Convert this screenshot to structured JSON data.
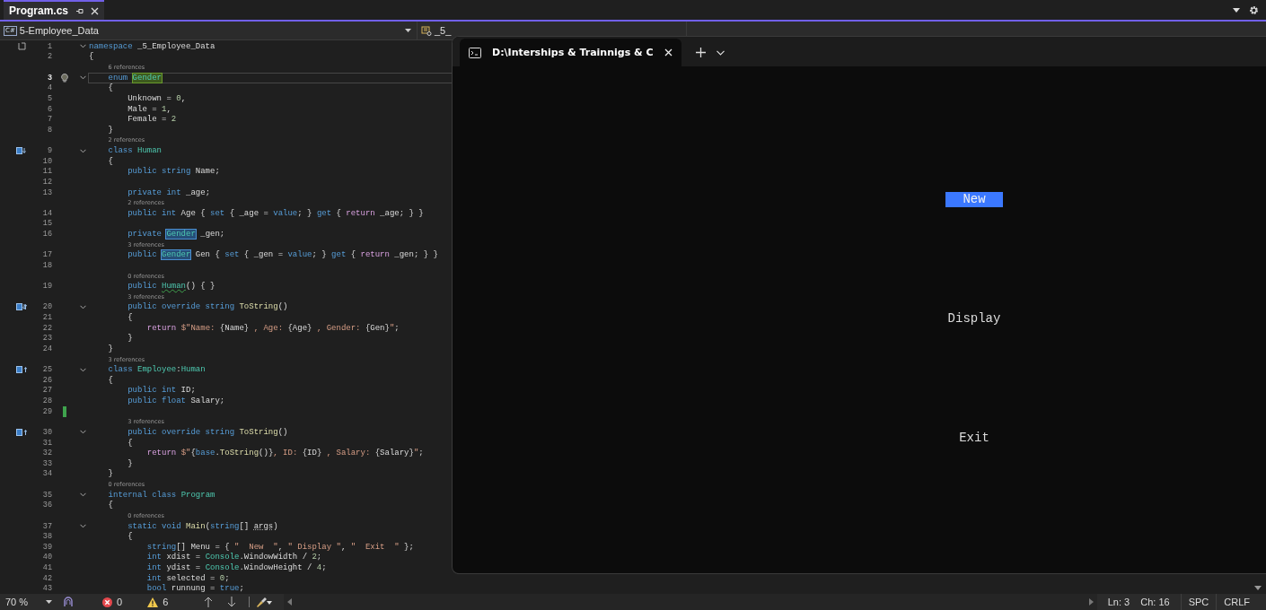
{
  "tabs": [
    {
      "label": "Program.cs",
      "selected": true
    }
  ],
  "nav": {
    "badge": "C#",
    "project": "5-Employee_Data",
    "member": "_5_"
  },
  "lines": [
    {
      "n": "1",
      "fold": true,
      "current": false,
      "margin": {
        "kind": "scope"
      },
      "tokens": [
        {
          "kind": "keyword",
          "t": "namespace"
        },
        {
          "kind": "plain",
          "t": " _5_Employee_Data"
        }
      ]
    },
    {
      "n": "2",
      "fold": false,
      "current": false,
      "tokens": [
        {
          "kind": "plain",
          "t": "{"
        }
      ]
    },
    {
      "n": "3",
      "lens": "6 references",
      "fold": true,
      "current": true,
      "gutter": {
        "kind": "bulb"
      },
      "tokens": [
        {
          "kind": "keyword",
          "t": "    enum "
        },
        {
          "kind": "definition",
          "t": "Gender"
        }
      ]
    },
    {
      "n": "4",
      "fold": false,
      "current": false,
      "tokens": [
        {
          "kind": "plain",
          "t": "    {"
        }
      ]
    },
    {
      "n": "5",
      "fold": false,
      "current": false,
      "tokens": [
        {
          "kind": "plain",
          "t": "        Unknown = "
        },
        {
          "kind": "number",
          "t": "0"
        },
        {
          "kind": "plain",
          "t": ","
        }
      ]
    },
    {
      "n": "6",
      "fold": false,
      "current": false,
      "tokens": [
        {
          "kind": "plain",
          "t": "        Male = "
        },
        {
          "kind": "number",
          "t": "1"
        },
        {
          "kind": "plain",
          "t": ","
        }
      ]
    },
    {
      "n": "7",
      "fold": false,
      "current": false,
      "tokens": [
        {
          "kind": "plain",
          "t": "        Female = "
        },
        {
          "kind": "number",
          "t": "2"
        }
      ]
    },
    {
      "n": "8",
      "fold": false,
      "current": false,
      "tokens": [
        {
          "kind": "plain",
          "t": "    }"
        }
      ]
    },
    {
      "n": "9",
      "lens": "2 references",
      "fold": true,
      "current": false,
      "margin": {
        "kind": "overridden"
      },
      "tokens": [
        {
          "kind": "keyword",
          "t": "    class "
        },
        {
          "kind": "type",
          "t": "Human"
        }
      ]
    },
    {
      "n": "10",
      "fold": false,
      "current": false,
      "tokens": [
        {
          "kind": "plain",
          "t": "    {"
        }
      ]
    },
    {
      "n": "11",
      "fold": false,
      "current": false,
      "tokens": [
        {
          "kind": "keyword",
          "t": "        public string"
        },
        {
          "kind": "plain",
          "t": " Name;"
        }
      ]
    },
    {
      "n": "12",
      "fold": false,
      "current": false
    },
    {
      "n": "13",
      "fold": false,
      "current": false,
      "tokens": [
        {
          "kind": "keyword",
          "t": "        private int"
        },
        {
          "kind": "plain",
          "t": " _age;"
        }
      ]
    },
    {
      "n": "14",
      "lens": "2 references",
      "fold": false,
      "current": false,
      "tokens": [
        {
          "kind": "keyword",
          "t": "        public int"
        },
        {
          "kind": "plain",
          "t": " Age { "
        },
        {
          "kind": "keyword",
          "t": "set"
        },
        {
          "kind": "plain",
          "t": " { _age = "
        },
        {
          "kind": "keyword",
          "t": "value"
        },
        {
          "kind": "plain",
          "t": "; } "
        },
        {
          "kind": "keyword",
          "t": "get"
        },
        {
          "kind": "plain",
          "t": " { "
        },
        {
          "kind": "control",
          "t": "return"
        },
        {
          "kind": "plain",
          "t": " _age; } }"
        }
      ]
    },
    {
      "n": "15",
      "fold": false,
      "current": false
    },
    {
      "n": "16",
      "fold": false,
      "current": false,
      "tokens": [
        {
          "kind": "keyword",
          "t": "        private "
        },
        {
          "kind": "reference",
          "t": "Gender"
        },
        {
          "kind": "plain",
          "t": " _gen;"
        }
      ]
    },
    {
      "n": "17",
      "lens": "3 references",
      "fold": false,
      "current": false,
      "tokens": [
        {
          "kind": "keyword",
          "t": "        public "
        },
        {
          "kind": "reference",
          "t": "Gender"
        },
        {
          "kind": "plain",
          "t": " Gen { "
        },
        {
          "kind": "keyword",
          "t": "set"
        },
        {
          "kind": "plain",
          "t": " { _gen = "
        },
        {
          "kind": "keyword",
          "t": "value"
        },
        {
          "kind": "plain",
          "t": "; } "
        },
        {
          "kind": "keyword",
          "t": "get"
        },
        {
          "kind": "plain",
          "t": " { "
        },
        {
          "kind": "control",
          "t": "return"
        },
        {
          "kind": "plain",
          "t": " _gen; } }"
        }
      ]
    },
    {
      "n": "18",
      "fold": false,
      "current": false
    },
    {
      "n": "19",
      "lens": "0 references",
      "fold": false,
      "current": false,
      "tokens": [
        {
          "kind": "keyword",
          "t": "        public "
        },
        {
          "kind": "squiggled",
          "t": "Human"
        },
        {
          "kind": "plain",
          "t": "() { }"
        }
      ]
    },
    {
      "n": "20",
      "lens": "3 references",
      "fold": true,
      "current": false,
      "margin": {
        "kind": "both"
      },
      "tokens": [
        {
          "kind": "keyword",
          "t": "        public override string "
        },
        {
          "kind": "method",
          "t": "ToString"
        },
        {
          "kind": "plain",
          "t": "()"
        }
      ]
    },
    {
      "n": "21",
      "fold": false,
      "current": false,
      "tokens": [
        {
          "kind": "plain",
          "t": "        {"
        }
      ]
    },
    {
      "n": "22",
      "fold": false,
      "current": false,
      "tokens": [
        {
          "kind": "control",
          "t": "            return "
        },
        {
          "kind": "string",
          "t": "$\"Name: "
        },
        {
          "kind": "plain",
          "t": "{Name}"
        },
        {
          "kind": "string",
          "t": " , Age: "
        },
        {
          "kind": "plain",
          "t": "{Age}"
        },
        {
          "kind": "string",
          "t": " , Gender: "
        },
        {
          "kind": "plain",
          "t": "{Gen}"
        },
        {
          "kind": "string",
          "t": "\""
        },
        {
          "kind": "plain",
          "t": ";"
        }
      ]
    },
    {
      "n": "23",
      "fold": false,
      "current": false,
      "tokens": [
        {
          "kind": "plain",
          "t": "        }"
        }
      ]
    },
    {
      "n": "24",
      "fold": false,
      "current": false,
      "tokens": [
        {
          "kind": "plain",
          "t": "    }"
        }
      ]
    },
    {
      "n": "25",
      "lens": "3 references",
      "fold": true,
      "current": false,
      "margin": {
        "kind": "overriding"
      },
      "tokens": [
        {
          "kind": "keyword",
          "t": "    class "
        },
        {
          "kind": "type",
          "t": "Employee"
        },
        {
          "kind": "plain",
          "t": ":"
        },
        {
          "kind": "type",
          "t": "Human"
        }
      ]
    },
    {
      "n": "26",
      "fold": false,
      "current": false,
      "tokens": [
        {
          "kind": "plain",
          "t": "    {"
        }
      ]
    },
    {
      "n": "27",
      "fold": false,
      "current": false,
      "tokens": [
        {
          "kind": "keyword",
          "t": "        public int"
        },
        {
          "kind": "plain",
          "t": " ID;"
        }
      ]
    },
    {
      "n": "28",
      "fold": false,
      "current": false,
      "tokens": [
        {
          "kind": "keyword",
          "t": "        public float"
        },
        {
          "kind": "plain",
          "t": " Salary;"
        }
      ]
    },
    {
      "n": "29",
      "fold": false,
      "current": false,
      "gutter": {
        "kind": "change"
      }
    },
    {
      "n": "30",
      "lens": "3 references",
      "fold": true,
      "current": false,
      "margin": {
        "kind": "overriding"
      },
      "tokens": [
        {
          "kind": "keyword",
          "t": "        public override string "
        },
        {
          "kind": "method",
          "t": "ToString"
        },
        {
          "kind": "plain",
          "t": "()"
        }
      ]
    },
    {
      "n": "31",
      "fold": false,
      "current": false,
      "tokens": [
        {
          "kind": "plain",
          "t": "        {"
        }
      ]
    },
    {
      "n": "32",
      "fold": false,
      "current": false,
      "tokens": [
        {
          "kind": "control",
          "t": "            return "
        },
        {
          "kind": "string",
          "t": "$\""
        },
        {
          "kind": "plain",
          "t": "{"
        },
        {
          "kind": "keyword",
          "t": "base"
        },
        {
          "kind": "plain",
          "t": "."
        },
        {
          "kind": "method",
          "t": "ToString"
        },
        {
          "kind": "plain",
          "t": "()}"
        },
        {
          "kind": "string",
          "t": ", ID: "
        },
        {
          "kind": "plain",
          "t": "{ID}"
        },
        {
          "kind": "string",
          "t": " , Salary: "
        },
        {
          "kind": "plain",
          "t": "{Salary}"
        },
        {
          "kind": "string",
          "t": "\""
        },
        {
          "kind": "plain",
          "t": ";"
        }
      ]
    },
    {
      "n": "33",
      "fold": false,
      "current": false,
      "tokens": [
        {
          "kind": "plain",
          "t": "        }"
        }
      ]
    },
    {
      "n": "34",
      "fold": false,
      "current": false,
      "tokens": [
        {
          "kind": "plain",
          "t": "    }"
        }
      ]
    },
    {
      "n": "35",
      "lens": "0 references",
      "fold": true,
      "current": false,
      "tokens": [
        {
          "kind": "keyword",
          "t": "    internal class "
        },
        {
          "kind": "type",
          "t": "Program"
        }
      ]
    },
    {
      "n": "36",
      "fold": false,
      "current": false,
      "tokens": [
        {
          "kind": "plain",
          "t": "    {"
        }
      ]
    },
    {
      "n": "37",
      "lens": "0 references",
      "fold": true,
      "current": false,
      "tokens": [
        {
          "kind": "keyword",
          "t": "        static void "
        },
        {
          "kind": "method",
          "t": "Main"
        },
        {
          "kind": "plain",
          "t": "("
        },
        {
          "kind": "keyword",
          "t": "string"
        },
        {
          "kind": "plain",
          "t": "[] "
        },
        {
          "kind": "dotted",
          "t": "args"
        },
        {
          "kind": "plain",
          "t": ")"
        }
      ]
    },
    {
      "n": "38",
      "fold": false,
      "current": false,
      "tokens": [
        {
          "kind": "plain",
          "t": "        {"
        }
      ]
    },
    {
      "n": "39",
      "fold": false,
      "current": false,
      "tokens": [
        {
          "kind": "keyword",
          "t": "            string"
        },
        {
          "kind": "plain",
          "t": "[] Menu = { "
        },
        {
          "kind": "string",
          "t": "\"  New  \""
        },
        {
          "kind": "plain",
          "t": ", "
        },
        {
          "kind": "string",
          "t": "\" Display \""
        },
        {
          "kind": "plain",
          "t": ", "
        },
        {
          "kind": "string",
          "t": "\"  Exit  \""
        },
        {
          "kind": "plain",
          "t": " };"
        }
      ]
    },
    {
      "n": "40",
      "fold": false,
      "current": false,
      "tokens": [
        {
          "kind": "keyword",
          "t": "            int"
        },
        {
          "kind": "plain",
          "t": " xdist = "
        },
        {
          "kind": "type",
          "t": "Console"
        },
        {
          "kind": "plain",
          "t": ".WindowWidth / "
        },
        {
          "kind": "number",
          "t": "2"
        },
        {
          "kind": "plain",
          "t": ";"
        }
      ]
    },
    {
      "n": "41",
      "fold": false,
      "current": false,
      "tokens": [
        {
          "kind": "keyword",
          "t": "            int"
        },
        {
          "kind": "plain",
          "t": " ydist = "
        },
        {
          "kind": "type",
          "t": "Console"
        },
        {
          "kind": "plain",
          "t": ".WindowHeight / "
        },
        {
          "kind": "number",
          "t": "4"
        },
        {
          "kind": "plain",
          "t": ";"
        }
      ]
    },
    {
      "n": "42",
      "fold": false,
      "current": false,
      "tokens": [
        {
          "kind": "keyword",
          "t": "            int"
        },
        {
          "kind": "plain",
          "t": " selected = "
        },
        {
          "kind": "number",
          "t": "0"
        },
        {
          "kind": "plain",
          "t": ";"
        }
      ]
    },
    {
      "n": "43",
      "fold": false,
      "current": false,
      "tokens": [
        {
          "kind": "keyword",
          "t": "            bool"
        },
        {
          "kind": "plain",
          "t": " runnung = "
        },
        {
          "kind": "keyword",
          "t": "true"
        },
        {
          "kind": "plain",
          "t": ";"
        }
      ]
    }
  ],
  "terminal": {
    "tab_title": "D:\\Interships & Trainnigs & C",
    "menu": [
      {
        "label": "New",
        "selected": true
      },
      {
        "label": "Display",
        "selected": false
      },
      {
        "label": "Exit",
        "selected": false
      }
    ]
  },
  "status": {
    "zoom": "70 %",
    "errors": "0",
    "warnings": "6",
    "line": "Ln: 3",
    "column": "Ch: 16",
    "indent": "SPC",
    "eol": "CRLF"
  }
}
